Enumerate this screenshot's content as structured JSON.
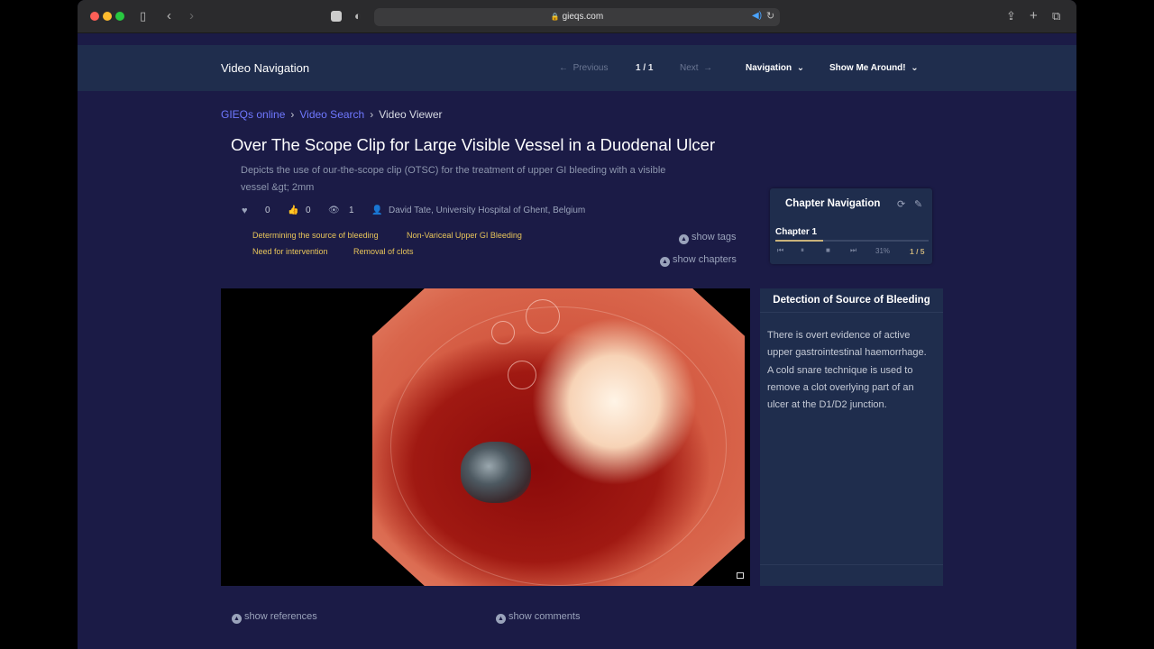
{
  "browser": {
    "url": "gieqs.com",
    "icons": [
      "sidebar-icon",
      "back-icon",
      "forward-icon",
      "tab-icon",
      "shield-icon",
      "lock-icon",
      "speaker-icon",
      "reload-icon",
      "share-icon",
      "new-tab-icon",
      "tab-overview-icon"
    ]
  },
  "navbar": {
    "title": "Video Navigation",
    "previous": "Previous",
    "page": "1 / 1",
    "next": "Next",
    "navigation": "Navigation",
    "show_me": "Show Me Around!"
  },
  "breadcrumb": {
    "items": [
      "GIEQs online",
      "Video Search",
      "Video Viewer"
    ]
  },
  "video_info": {
    "title": "Over The Scope Clip for Large Visible Vessel in a Duodenal Ulcer",
    "description": "Depicts the use of our-the-scope clip (OTSC) for the treatment of upper GI bleeding with a visible vessel &gt; 2mm",
    "likes": "0",
    "thumbs": "0",
    "views": "1",
    "author": "David Tate, University Hospital of Ghent, Belgium",
    "tags": [
      "Determining the source of bleeding",
      "Non-Variceal Upper GI Bleeding",
      "Need for intervention",
      "Removal of clots"
    ],
    "show_tags": "show tags",
    "show_chapters": "show chapters"
  },
  "chapter_nav": {
    "title": "Chapter Navigation",
    "chapter": "Chapter 1",
    "progress_label": "31%",
    "progress": 0.31,
    "count": "1 / 5"
  },
  "chapter_panel": {
    "title": "Detection of Source of Bleeding",
    "body": "There is overt evidence of active upper gastrointestinal haemorrhage. A cold snare technique is used to remove a clot overlying part of an ulcer at the D1/D2 junction."
  },
  "footer": {
    "show_references": "show references",
    "show_comments": "show comments"
  },
  "colors": {
    "background": "#1b1b46",
    "navbar": "#1f2d4d",
    "link": "#6f78ff",
    "tag": "#e8c55a",
    "accent": "#c9b27a"
  }
}
